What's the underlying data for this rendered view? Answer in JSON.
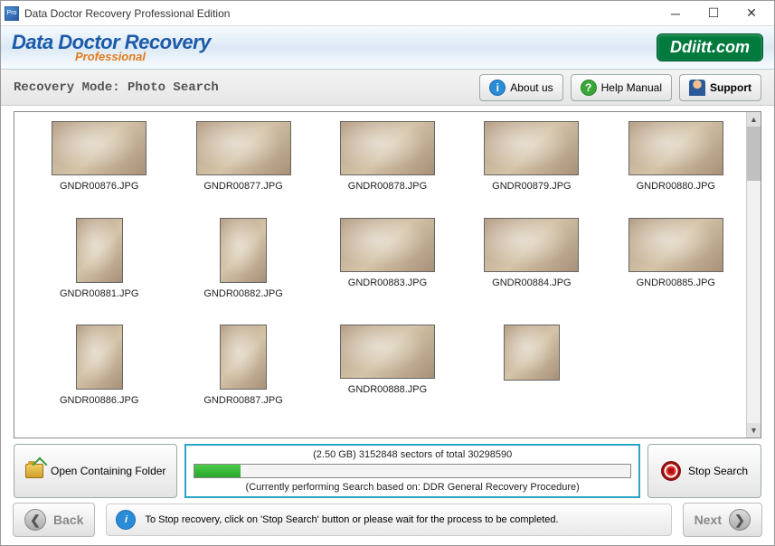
{
  "titlebar": {
    "title": "Data Doctor Recovery Professional Edition"
  },
  "banner": {
    "brand_main": "Data Doctor Recovery",
    "brand_sub": "Professional",
    "site": "Ddiitt.com"
  },
  "modebar": {
    "label": "Recovery Mode: Photo Search",
    "about": "About us",
    "help": "Help Manual",
    "support": "Support"
  },
  "files": [
    {
      "name": "GNDR00876.JPG",
      "shape": "land"
    },
    {
      "name": "GNDR00877.JPG",
      "shape": "land"
    },
    {
      "name": "GNDR00878.JPG",
      "shape": "land"
    },
    {
      "name": "GNDR00879.JPG",
      "shape": "land"
    },
    {
      "name": "GNDR00880.JPG",
      "shape": "land"
    },
    {
      "name": "GNDR00881.JPG",
      "shape": "port"
    },
    {
      "name": "GNDR00882.JPG",
      "shape": "port"
    },
    {
      "name": "GNDR00883.JPG",
      "shape": "land"
    },
    {
      "name": "GNDR00884.JPG",
      "shape": "land"
    },
    {
      "name": "GNDR00885.JPG",
      "shape": "land"
    },
    {
      "name": "GNDR00886.JPG",
      "shape": "port"
    },
    {
      "name": "GNDR00887.JPG",
      "shape": "port"
    },
    {
      "name": "GNDR00888.JPG",
      "shape": "land"
    },
    {
      "name": "",
      "shape": "square"
    }
  ],
  "progress": {
    "text": "(2.50 GB) 3152848  sectors  of  total 30298590",
    "open_folder": "Open Containing Folder",
    "subtext": "(Currently performing Search based on:  DDR General Recovery Procedure)",
    "stop": "Stop Search",
    "percent": 10.4
  },
  "footer": {
    "back": "Back",
    "next": "Next",
    "tip": "To Stop recovery, click on 'Stop Search' button or please wait for the process to be completed."
  }
}
